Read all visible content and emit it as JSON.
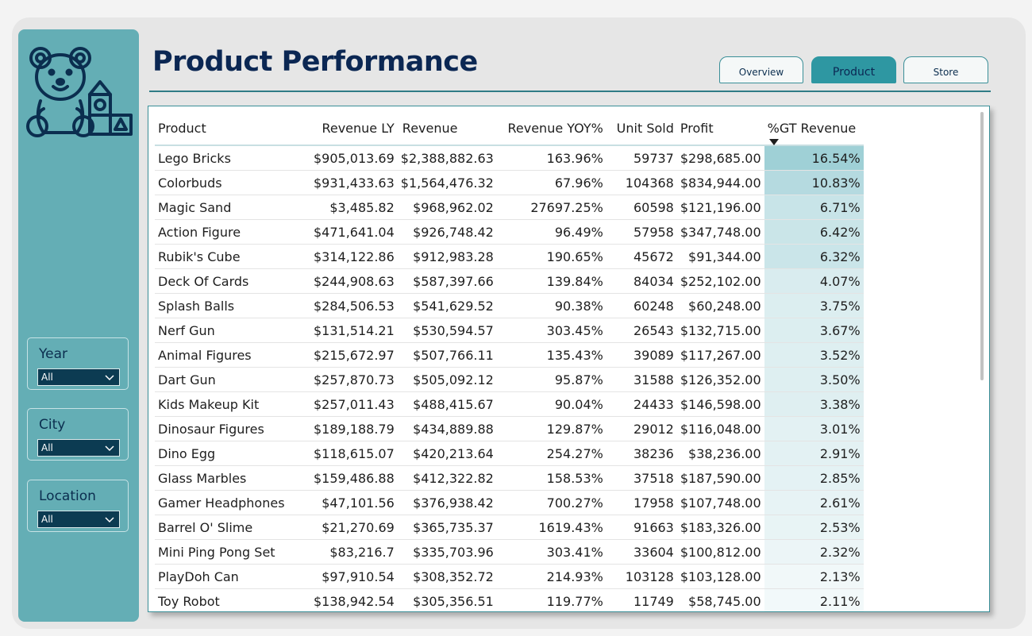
{
  "page": {
    "title": "Product Performance"
  },
  "tabs": [
    {
      "label": "Overview"
    },
    {
      "label": "Product"
    },
    {
      "label": "Store"
    }
  ],
  "filters": [
    {
      "label": "Year",
      "value": "All"
    },
    {
      "label": "City",
      "value": "All"
    },
    {
      "label": "Location",
      "value": "All"
    }
  ],
  "table": {
    "columns": [
      "Product",
      "Revenue LY",
      "Revenue",
      "Revenue YOY%",
      "Unit Sold",
      "Profit",
      "%GT Revenue"
    ],
    "rows": [
      [
        "Lego Bricks",
        "$905,013.69",
        "$2,388,882.63",
        "163.96%",
        "59737",
        "$298,685.00",
        "16.54%"
      ],
      [
        "Colorbuds",
        "$931,433.63",
        "$1,564,476.32",
        "67.96%",
        "104368",
        "$834,944.00",
        "10.83%"
      ],
      [
        "Magic Sand",
        "$3,485.82",
        "$968,962.02",
        "27697.25%",
        "60598",
        "$121,196.00",
        "6.71%"
      ],
      [
        "Action Figure",
        "$471,641.04",
        "$926,748.42",
        "96.49%",
        "57958",
        "$347,748.00",
        "6.42%"
      ],
      [
        "Rubik's Cube",
        "$314,122.86",
        "$912,983.28",
        "190.65%",
        "45672",
        "$91,344.00",
        "6.32%"
      ],
      [
        "Deck Of Cards",
        "$244,908.63",
        "$587,397.66",
        "139.84%",
        "84034",
        "$252,102.00",
        "4.07%"
      ],
      [
        "Splash Balls",
        "$284,506.53",
        "$541,629.52",
        "90.38%",
        "60248",
        "$60,248.00",
        "3.75%"
      ],
      [
        "Nerf Gun",
        "$131,514.21",
        "$530,594.57",
        "303.45%",
        "26543",
        "$132,715.00",
        "3.67%"
      ],
      [
        "Animal Figures",
        "$215,672.97",
        "$507,766.11",
        "135.43%",
        "39089",
        "$117,267.00",
        "3.52%"
      ],
      [
        "Dart Gun",
        "$257,870.73",
        "$505,092.12",
        "95.87%",
        "31588",
        "$126,352.00",
        "3.50%"
      ],
      [
        "Kids Makeup Kit",
        "$257,011.43",
        "$488,415.67",
        "90.04%",
        "24433",
        "$146,598.00",
        "3.38%"
      ],
      [
        "Dinosaur Figures",
        "$189,188.79",
        "$434,889.88",
        "129.87%",
        "29012",
        "$116,048.00",
        "3.01%"
      ],
      [
        "Dino Egg",
        "$118,615.07",
        "$420,213.64",
        "254.27%",
        "38236",
        "$38,236.00",
        "2.91%"
      ],
      [
        "Glass Marbles",
        "$159,486.88",
        "$412,322.82",
        "158.53%",
        "37518",
        "$187,590.00",
        "2.85%"
      ],
      [
        "Gamer Headphones",
        "$47,101.56",
        "$376,938.42",
        "700.27%",
        "17958",
        "$107,748.00",
        "2.61%"
      ],
      [
        "Barrel O' Slime",
        "$21,270.69",
        "$365,735.37",
        "1619.43%",
        "91663",
        "$183,326.00",
        "2.53%"
      ],
      [
        "Mini Ping Pong Set",
        "$83,216.7",
        "$335,703.96",
        "303.41%",
        "33604",
        "$100,812.00",
        "2.32%"
      ],
      [
        "PlayDoh Can",
        "$97,910.54",
        "$308,352.72",
        "214.93%",
        "103128",
        "$103,128.00",
        "2.13%"
      ],
      [
        "Toy Robot",
        "$138,942.54",
        "$305,356.51",
        "119.77%",
        "11749",
        "$58,745.00",
        "2.11%"
      ]
    ],
    "sort": {
      "column": "%GT Revenue",
      "direction": "descending"
    },
    "heat_color": "#5fb0bb"
  },
  "colors": {
    "accent": "#2e97a2",
    "sidebar": "#64aeb5",
    "title": "#0b2753",
    "filter_select": "#0c3b52"
  },
  "icons": {
    "logo": "teddy-bear-and-blocks-icon",
    "dropdown": "chevron-down-icon",
    "sort": "sort-descending-icon"
  }
}
